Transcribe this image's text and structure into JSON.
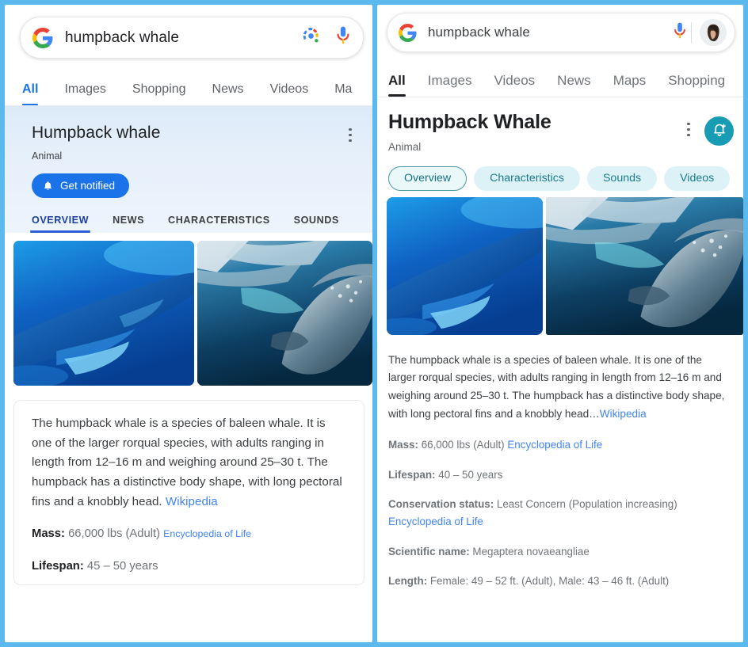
{
  "theme": {
    "frame_border": "#5cb9ed",
    "google_blue": "#1a73e8",
    "link_blue": "#4285f4",
    "teal_accent": "#189cb4",
    "chip_bg": "#ddf2f7",
    "left_panel_bg": "#e6f0fb"
  },
  "left": {
    "search": {
      "query": "humpback whale",
      "logo": "google-logo",
      "lens_icon": "google-lens-icon",
      "mic_icon": "microphone-icon"
    },
    "nav_tabs": [
      {
        "label": "All",
        "active": true
      },
      {
        "label": "Images",
        "active": false
      },
      {
        "label": "Shopping",
        "active": false
      },
      {
        "label": "News",
        "active": false
      },
      {
        "label": "Videos",
        "active": false
      },
      {
        "label": "Ma",
        "active": false
      }
    ],
    "knowledge": {
      "title": "Humpback whale",
      "subtitle": "Animal",
      "overflow_icon": "more-vertical-icon",
      "notify_button": {
        "label": "Get notified",
        "icon": "bell-icon"
      },
      "tabs": [
        {
          "label": "OVERVIEW",
          "active": true
        },
        {
          "label": "NEWS",
          "active": false
        },
        {
          "label": "CHARACTERISTICS",
          "active": false
        },
        {
          "label": "SOUNDS",
          "active": false
        }
      ],
      "images": [
        {
          "alt": "humpback-whale-swimming-blue-water"
        },
        {
          "alt": "humpback-whale-near-surface"
        }
      ],
      "description": "The humpback whale is a species of baleen whale. It is one of the larger rorqual species, with adults ranging in length from 12–16 m and weighing around 25–30 t. The humpback has a distinctive body shape, with long pectoral fins and a knobbly head. ",
      "description_link": "Wikipedia",
      "facts": [
        {
          "label": "Mass:",
          "value": " 66,000 lbs (Adult) ",
          "link": "Encyclopedia of Life"
        },
        {
          "label": "Lifespan:",
          "value": " 45 – 50 years",
          "link": ""
        }
      ]
    }
  },
  "right": {
    "search": {
      "query": "humpback whale",
      "logo": "google-logo",
      "mic_icon": "microphone-icon",
      "avatar": "user-avatar"
    },
    "nav_tabs": [
      {
        "label": "All",
        "active": true
      },
      {
        "label": "Images",
        "active": false
      },
      {
        "label": "Videos",
        "active": false
      },
      {
        "label": "News",
        "active": false
      },
      {
        "label": "Maps",
        "active": false
      },
      {
        "label": "Shopping",
        "active": false
      }
    ],
    "knowledge": {
      "title": "Humpback Whale",
      "subtitle": "Animal",
      "overflow_icon": "more-vertical-icon",
      "notify_icon": "bell-add-icon",
      "chips": [
        {
          "label": "Overview",
          "active": true
        },
        {
          "label": "Characteristics",
          "active": false
        },
        {
          "label": "Sounds",
          "active": false
        },
        {
          "label": "Videos",
          "active": false
        }
      ],
      "images": [
        {
          "alt": "humpback-whale-swimming-blue-water"
        },
        {
          "alt": "humpback-whale-near-surface"
        }
      ],
      "description": "The humpback whale is a species of baleen whale. It is one of the larger rorqual species, with adults ranging in length from 12–16 m and weighing around 25–30 t. The humpback has a distinctive body shape, with long pectoral fins and a knobbly head…",
      "description_link": "Wikipedia",
      "facts": [
        {
          "label": "Mass:",
          "value": " 66,000 lbs (Adult) ",
          "link": "Encyclopedia of Life"
        },
        {
          "label": "Lifespan:",
          "value": " 40 – 50 years",
          "link": ""
        },
        {
          "label": "Conservation status:",
          "value": " Least Concern (Population increasing) ",
          "link": "Encyclopedia of Life"
        },
        {
          "label": "Scientific name:",
          "value": " Megaptera novaeangliae",
          "link": ""
        },
        {
          "label": "Length:",
          "value": " Female: 49 – 52 ft. (Adult), Male: 43 – 46 ft. (Adult)",
          "link": ""
        }
      ]
    }
  }
}
